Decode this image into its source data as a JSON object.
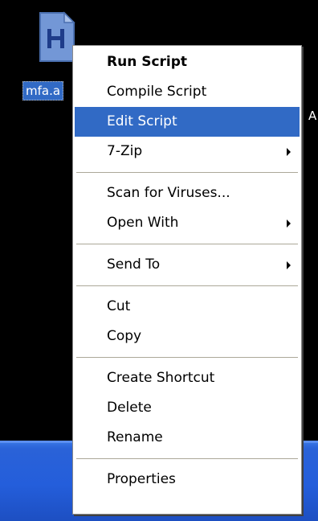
{
  "desktop": {
    "icon_label": "mfa.a",
    "peek_text": "A"
  },
  "menu": {
    "run_script": "Run Script",
    "compile_script": "Compile Script",
    "edit_script": "Edit Script",
    "seven_zip": "7-Zip",
    "scan_viruses": "Scan for Viruses...",
    "open_with": "Open With",
    "send_to": "Send To",
    "cut": "Cut",
    "copy": "Copy",
    "create_shortcut": "Create Shortcut",
    "delete": "Delete",
    "rename": "Rename",
    "properties": "Properties"
  },
  "colors": {
    "desktop_bg": "#000000",
    "highlight": "#316ac5",
    "menu_bg": "#ffffff",
    "taskbar": "#245edb",
    "icon_blue": "#7397d6"
  },
  "icons": {
    "file": "autohotkey-file-icon",
    "submenu": "submenu-arrow-icon"
  }
}
